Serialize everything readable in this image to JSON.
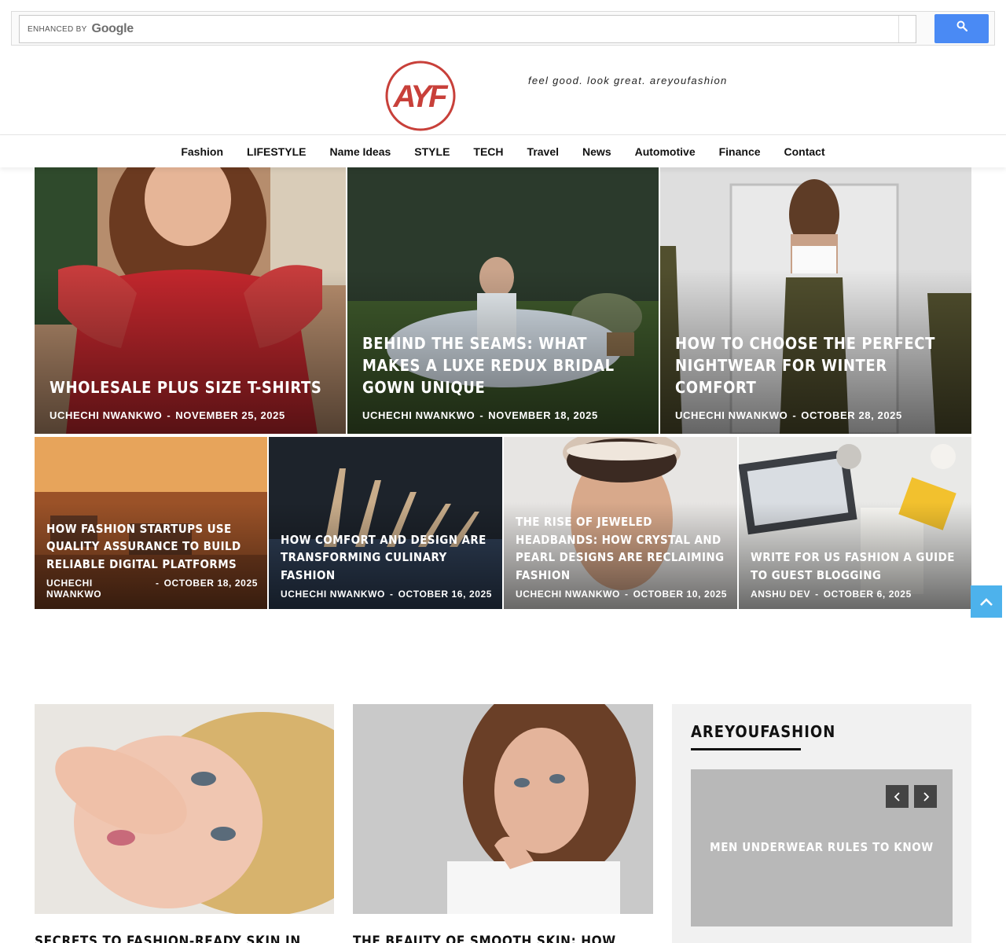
{
  "search": {
    "enhanced_by": "ENHANCED BY",
    "google": "Google"
  },
  "header": {
    "logo_text": "AYF",
    "tagline": "feel good. look great. areyoufashion"
  },
  "nav": {
    "items": [
      "Fashion",
      "LIFESTYLE",
      "Name Ideas",
      "STYLE",
      "TECH",
      "Travel",
      "News",
      "Automotive",
      "Finance",
      "Contact"
    ]
  },
  "hero": [
    {
      "title": "WHOLESALE PLUS SIZE T-SHIRTS",
      "author": "UCHECHI NWANKWO",
      "date": "NOVEMBER 25, 2025"
    },
    {
      "title": "BEHIND THE SEAMS: WHAT MAKES A LUXE REDUX BRIDAL GOWN UNIQUE",
      "author": "UCHECHI NWANKWO",
      "date": "NOVEMBER 18, 2025"
    },
    {
      "title": "HOW TO CHOOSE THE PERFECT NIGHTWEAR FOR WINTER COMFORT",
      "author": "UCHECHI NWANKWO",
      "date": "OCTOBER 28, 2025"
    },
    {
      "title": "HOW FASHION STARTUPS USE QUALITY ASSURANCE TO BUILD RELIABLE DIGITAL PLATFORMS",
      "author": "UCHECHI NWANKWO",
      "date": "OCTOBER 18, 2025"
    },
    {
      "title": "HOW COMFORT AND DESIGN ARE TRANSFORMING CULINARY FASHION",
      "author": "UCHECHI NWANKWO",
      "date": "OCTOBER 16, 2025"
    },
    {
      "title": "THE RISE OF JEWELED HEADBANDS: HOW CRYSTAL AND PEARL DESIGNS ARE RECLAIMING FASHION",
      "author": "UCHECHI NWANKWO",
      "date": "OCTOBER 10, 2025"
    },
    {
      "title": "WRITE FOR US FASHION A GUIDE TO GUEST BLOGGING",
      "author": "ANSHU DEV",
      "date": "OCTOBER 6, 2025"
    }
  ],
  "meta_sep": "-",
  "articles": [
    {
      "title": "SECRETS TO FASHION-READY SKIN IN"
    },
    {
      "title": "THE BEAUTY OF SMOOTH SKIN: HOW"
    }
  ],
  "sidebar": {
    "title": "AREYOUFASHION",
    "slide_title": "MEN UNDERWEAR RULES TO KNOW"
  },
  "colors": {
    "brand_red": "#c8403a",
    "search_blue": "#4a8af4",
    "to_top_blue": "#4db2ec"
  }
}
